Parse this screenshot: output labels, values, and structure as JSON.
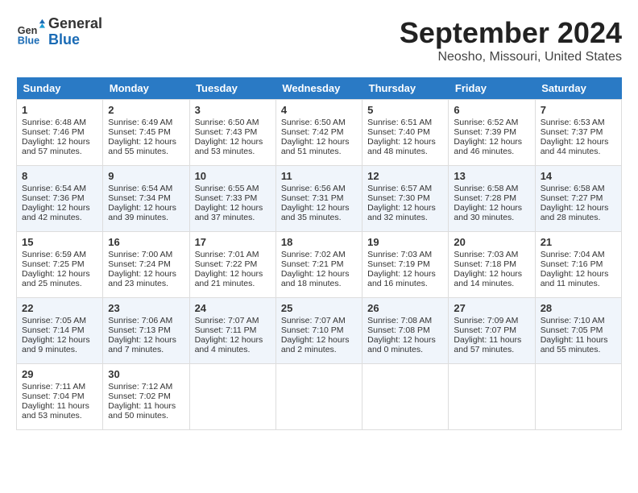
{
  "header": {
    "logo_general": "General",
    "logo_blue": "Blue",
    "month": "September 2024",
    "location": "Neosho, Missouri, United States"
  },
  "columns": [
    "Sunday",
    "Monday",
    "Tuesday",
    "Wednesday",
    "Thursday",
    "Friday",
    "Saturday"
  ],
  "weeks": [
    [
      {
        "day": "1",
        "sunrise": "6:48 AM",
        "sunset": "7:46 PM",
        "daylight": "12 hours and 57 minutes."
      },
      {
        "day": "2",
        "sunrise": "6:49 AM",
        "sunset": "7:45 PM",
        "daylight": "12 hours and 55 minutes."
      },
      {
        "day": "3",
        "sunrise": "6:50 AM",
        "sunset": "7:43 PM",
        "daylight": "12 hours and 53 minutes."
      },
      {
        "day": "4",
        "sunrise": "6:50 AM",
        "sunset": "7:42 PM",
        "daylight": "12 hours and 51 minutes."
      },
      {
        "day": "5",
        "sunrise": "6:51 AM",
        "sunset": "7:40 PM",
        "daylight": "12 hours and 48 minutes."
      },
      {
        "day": "6",
        "sunrise": "6:52 AM",
        "sunset": "7:39 PM",
        "daylight": "12 hours and 46 minutes."
      },
      {
        "day": "7",
        "sunrise": "6:53 AM",
        "sunset": "7:37 PM",
        "daylight": "12 hours and 44 minutes."
      }
    ],
    [
      {
        "day": "8",
        "sunrise": "6:54 AM",
        "sunset": "7:36 PM",
        "daylight": "12 hours and 42 minutes."
      },
      {
        "day": "9",
        "sunrise": "6:54 AM",
        "sunset": "7:34 PM",
        "daylight": "12 hours and 39 minutes."
      },
      {
        "day": "10",
        "sunrise": "6:55 AM",
        "sunset": "7:33 PM",
        "daylight": "12 hours and 37 minutes."
      },
      {
        "day": "11",
        "sunrise": "6:56 AM",
        "sunset": "7:31 PM",
        "daylight": "12 hours and 35 minutes."
      },
      {
        "day": "12",
        "sunrise": "6:57 AM",
        "sunset": "7:30 PM",
        "daylight": "12 hours and 32 minutes."
      },
      {
        "day": "13",
        "sunrise": "6:58 AM",
        "sunset": "7:28 PM",
        "daylight": "12 hours and 30 minutes."
      },
      {
        "day": "14",
        "sunrise": "6:58 AM",
        "sunset": "7:27 PM",
        "daylight": "12 hours and 28 minutes."
      }
    ],
    [
      {
        "day": "15",
        "sunrise": "6:59 AM",
        "sunset": "7:25 PM",
        "daylight": "12 hours and 25 minutes."
      },
      {
        "day": "16",
        "sunrise": "7:00 AM",
        "sunset": "7:24 PM",
        "daylight": "12 hours and 23 minutes."
      },
      {
        "day": "17",
        "sunrise": "7:01 AM",
        "sunset": "7:22 PM",
        "daylight": "12 hours and 21 minutes."
      },
      {
        "day": "18",
        "sunrise": "7:02 AM",
        "sunset": "7:21 PM",
        "daylight": "12 hours and 18 minutes."
      },
      {
        "day": "19",
        "sunrise": "7:03 AM",
        "sunset": "7:19 PM",
        "daylight": "12 hours and 16 minutes."
      },
      {
        "day": "20",
        "sunrise": "7:03 AM",
        "sunset": "7:18 PM",
        "daylight": "12 hours and 14 minutes."
      },
      {
        "day": "21",
        "sunrise": "7:04 AM",
        "sunset": "7:16 PM",
        "daylight": "12 hours and 11 minutes."
      }
    ],
    [
      {
        "day": "22",
        "sunrise": "7:05 AM",
        "sunset": "7:14 PM",
        "daylight": "12 hours and 9 minutes."
      },
      {
        "day": "23",
        "sunrise": "7:06 AM",
        "sunset": "7:13 PM",
        "daylight": "12 hours and 7 minutes."
      },
      {
        "day": "24",
        "sunrise": "7:07 AM",
        "sunset": "7:11 PM",
        "daylight": "12 hours and 4 minutes."
      },
      {
        "day": "25",
        "sunrise": "7:07 AM",
        "sunset": "7:10 PM",
        "daylight": "12 hours and 2 minutes."
      },
      {
        "day": "26",
        "sunrise": "7:08 AM",
        "sunset": "7:08 PM",
        "daylight": "12 hours and 0 minutes."
      },
      {
        "day": "27",
        "sunrise": "7:09 AM",
        "sunset": "7:07 PM",
        "daylight": "11 hours and 57 minutes."
      },
      {
        "day": "28",
        "sunrise": "7:10 AM",
        "sunset": "7:05 PM",
        "daylight": "11 hours and 55 minutes."
      }
    ],
    [
      {
        "day": "29",
        "sunrise": "7:11 AM",
        "sunset": "7:04 PM",
        "daylight": "11 hours and 53 minutes."
      },
      {
        "day": "30",
        "sunrise": "7:12 AM",
        "sunset": "7:02 PM",
        "daylight": "11 hours and 50 minutes."
      },
      null,
      null,
      null,
      null,
      null
    ]
  ]
}
